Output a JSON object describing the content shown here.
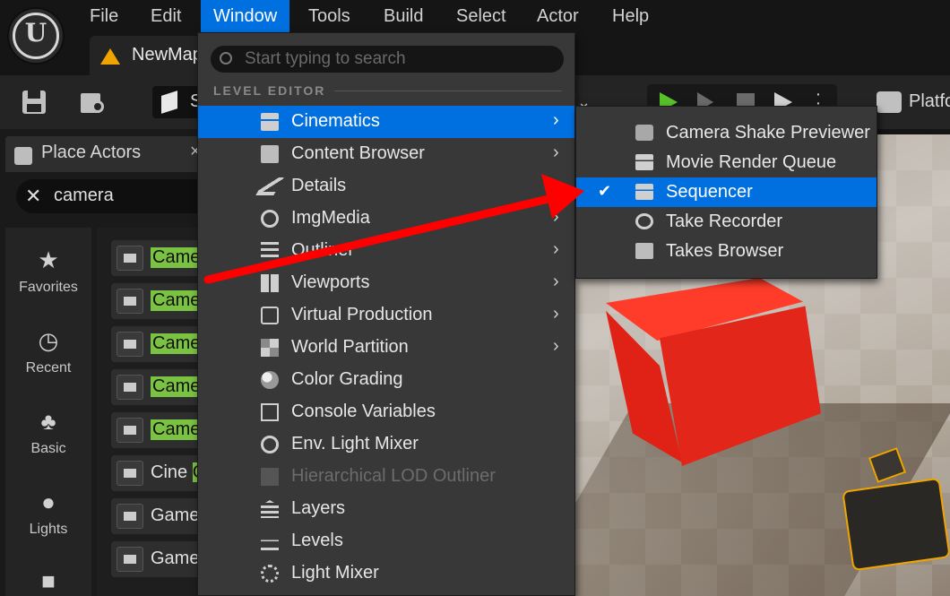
{
  "menubar": {
    "items": [
      "File",
      "Edit",
      "Window",
      "Tools",
      "Build",
      "Select",
      "Actor",
      "Help"
    ]
  },
  "tab": {
    "label": "NewMap"
  },
  "toolbar": {
    "mode_label": "S",
    "platforms_label": "Platfo"
  },
  "place_actors": {
    "title": "Place Actors",
    "search_value": "camera",
    "categories": [
      "Favorites",
      "Recent",
      "Basic",
      "Lights"
    ],
    "actors": [
      {
        "name": "Came",
        "match": "Came",
        "rest": ""
      },
      {
        "name": "Came",
        "match": "Came",
        "rest": ""
      },
      {
        "name": "Came",
        "match": "Came",
        "rest": ""
      },
      {
        "name": "Came",
        "match": "Came",
        "rest": ""
      },
      {
        "name": "Came",
        "match": "Came",
        "rest": ""
      },
      {
        "name": "Cine C",
        "match": "C",
        "rest": "Cine "
      },
      {
        "name": "Game",
        "match": "",
        "rest": "Game"
      },
      {
        "name": "Game",
        "match": "",
        "rest": "Game"
      }
    ]
  },
  "window_menu": {
    "search_placeholder": "Start typing to search",
    "section_label": "LEVEL EDITOR",
    "items": [
      {
        "label": "Cinematics",
        "icon": "clapper-icon",
        "submenu": true,
        "disabled": false
      },
      {
        "label": "Content Browser",
        "icon": "folder-search-icon",
        "submenu": true,
        "disabled": false
      },
      {
        "label": "Details",
        "icon": "pencil-icon",
        "submenu": true,
        "disabled": false
      },
      {
        "label": "ImgMedia",
        "icon": "film-reel-icon",
        "submenu": true,
        "disabled": false
      },
      {
        "label": "Outliner",
        "icon": "list-icon",
        "submenu": true,
        "disabled": false
      },
      {
        "label": "Viewports",
        "icon": "grid-icon",
        "submenu": true,
        "disabled": false
      },
      {
        "label": "Virtual Production",
        "icon": "person-frame-icon",
        "submenu": true,
        "disabled": false
      },
      {
        "label": "World Partition",
        "icon": "world-grid-icon",
        "submenu": true,
        "disabled": false
      },
      {
        "label": "Color Grading",
        "icon": "color-wheel-icon",
        "submenu": false,
        "disabled": false
      },
      {
        "label": "Console Variables",
        "icon": "console-icon",
        "submenu": false,
        "disabled": false
      },
      {
        "label": "Env. Light Mixer",
        "icon": "light-mixer-icon",
        "submenu": false,
        "disabled": false
      },
      {
        "label": "Hierarchical LOD Outliner",
        "icon": "lod-icon",
        "submenu": false,
        "disabled": true
      },
      {
        "label": "Layers",
        "icon": "layers-icon",
        "submenu": false,
        "disabled": false
      },
      {
        "label": "Levels",
        "icon": "levels-icon",
        "submenu": false,
        "disabled": false
      },
      {
        "label": "Light Mixer",
        "icon": "sun-icon",
        "submenu": false,
        "disabled": false
      }
    ]
  },
  "cinematics_submenu": {
    "items": [
      {
        "label": "Camera Shake Previewer",
        "icon": "camera-icon",
        "checked": false
      },
      {
        "label": "Movie Render Queue",
        "icon": "clapper-icon",
        "checked": false
      },
      {
        "label": "Sequencer",
        "icon": "clapper-icon",
        "checked": true
      },
      {
        "label": "Take Recorder",
        "icon": "film-reel-icon",
        "checked": false
      },
      {
        "label": "Takes Browser",
        "icon": "folder-search-icon",
        "checked": false
      }
    ]
  },
  "colors": {
    "highlight": "#0070e0",
    "search_match": "#7cc242",
    "annotation_arrow": "#ff0000",
    "play_green": "#58c22a"
  }
}
